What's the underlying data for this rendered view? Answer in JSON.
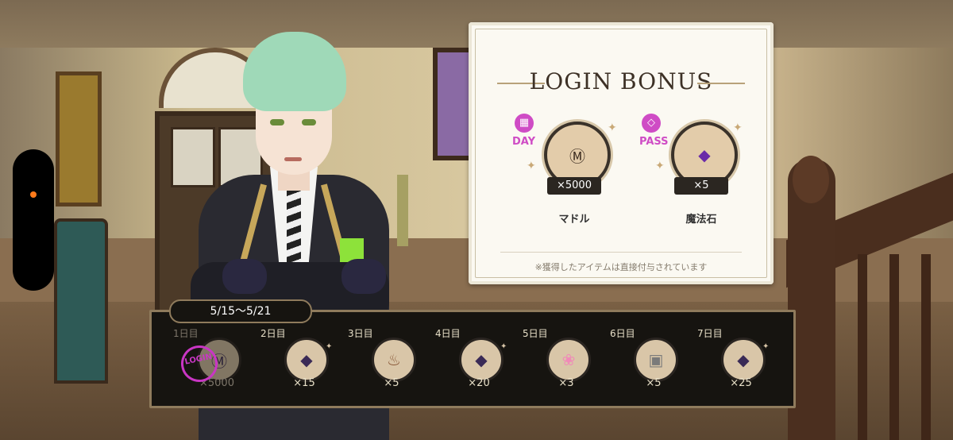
{
  "login_bonus": {
    "title": "LOGIN BONUS",
    "rewards": [
      {
        "tag": "DAY",
        "icon": "calendar-icon",
        "item_icon": "madol-ticket-icon",
        "count": "×5000",
        "name": "マドル"
      },
      {
        "tag": "PASS",
        "icon": "diamond-icon",
        "item_icon": "magic-stone-icon",
        "count": "×5",
        "name": "魔法石"
      }
    ],
    "note": "※獲得したアイテムは直接付与されています"
  },
  "weekly": {
    "period": "5/15〜5/21",
    "days": [
      {
        "label": "1日目",
        "count": "×5000",
        "icon": "madol-ticket-icon",
        "claimed": true
      },
      {
        "label": "2日目",
        "count": "×15",
        "icon": "magic-stone-icon",
        "claimed": false
      },
      {
        "label": "3日目",
        "count": "×5",
        "icon": "cupcake-icon",
        "claimed": false
      },
      {
        "label": "4日目",
        "count": "×20",
        "icon": "magic-stone-icon",
        "claimed": false
      },
      {
        "label": "5日目",
        "count": "×3",
        "icon": "cotton-candy-icon",
        "claimed": false
      },
      {
        "label": "6日目",
        "count": "×5",
        "icon": "sugar-cubes-icon",
        "claimed": false
      },
      {
        "label": "7日目",
        "count": "×25",
        "icon": "magic-stone-icon",
        "claimed": false
      }
    ],
    "stamp_text": "LOGIN"
  },
  "colors": {
    "accent_pink": "#cf4cc5",
    "strip_bg": "#161410",
    "card_bg": "#fbf9f2",
    "notification_dot": "#ff7a1a"
  }
}
